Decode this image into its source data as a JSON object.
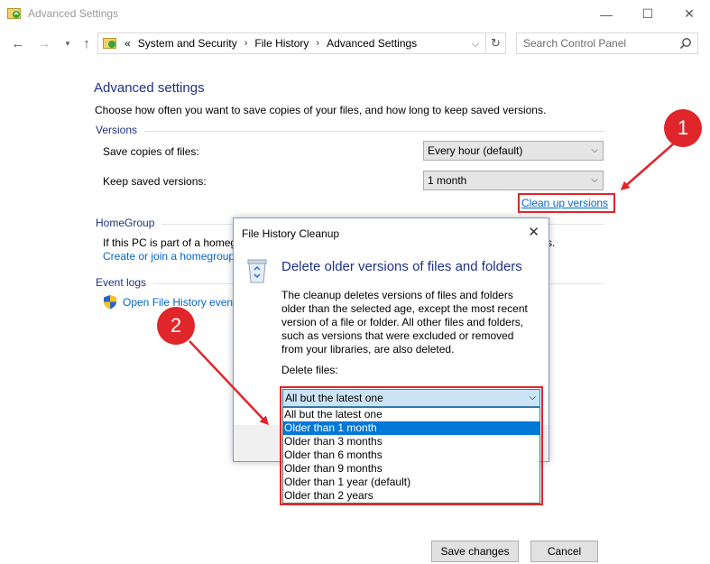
{
  "window": {
    "title": "Advanced Settings",
    "minimize": "—",
    "maximize": "☐",
    "close": "✕"
  },
  "nav": {
    "back": "←",
    "forward": "→",
    "up": "↑",
    "crumb_prefix": "«",
    "breadcrumbs": [
      "System and Security",
      "File History",
      "Advanced Settings"
    ],
    "separator": "›",
    "dropdown": "⌵",
    "refresh": "↻",
    "search_placeholder": "Search Control Panel"
  },
  "main": {
    "title": "Advanced settings",
    "intro": "Choose how often you want to save copies of your files, and how long to keep saved versions.",
    "versions": {
      "heading": "Versions",
      "save_label": "Save copies of files:",
      "save_value": "Every hour (default)",
      "keep_label": "Keep saved versions:",
      "keep_value": "1 month",
      "cleanup_link": "Clean up versions"
    },
    "homegroup": {
      "heading": "HomeGroup",
      "text": "If this PC is part of a homeg",
      "text_tail": "s.",
      "link": "Create or join a homegroup"
    },
    "event_logs": {
      "heading": "Event logs",
      "link": "Open File History event"
    },
    "buttons": {
      "save": "Save changes",
      "cancel": "Cancel"
    }
  },
  "dialog": {
    "title": "File History Cleanup",
    "close": "✕",
    "heading": "Delete older versions of files and folders",
    "description": "The cleanup deletes versions of files and folders older than the selected age, except the most recent version of a file or folder. All other files and folders, such as versions that were excluded or removed from your libraries, are also deleted.",
    "delete_label": "Delete files:",
    "selected": "All but the latest one",
    "arrow": "⌵",
    "options": [
      "All but the latest one",
      "Older than 1 month",
      "Older than 3 months",
      "Older than 6 months",
      "Older than 9 months",
      "Older than 1 year (default)",
      "Older than 2 years"
    ],
    "highlighted_option": "Older than 1 month"
  },
  "annotations": {
    "badge1": "1",
    "badge2": "2",
    "color": "#e0262b"
  },
  "colors": {
    "heading": "#1e3287",
    "link": "#0066cc",
    "selection": "#0078d7"
  }
}
